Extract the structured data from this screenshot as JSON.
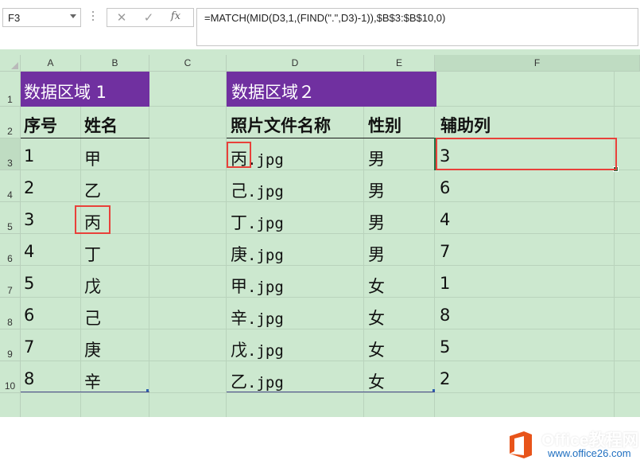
{
  "formula_bar": {
    "name_box": "F3",
    "cancel_glyph": "✕",
    "enter_glyph": "✓",
    "fx_label": "fx",
    "formula": "=MATCH(MID(D3,1,(FIND(\".\",D3)-1)),$B$3:$B$10,0)"
  },
  "columns": [
    "A",
    "B",
    "C",
    "D",
    "E",
    "F"
  ],
  "rows": [
    "1",
    "2",
    "3",
    "4",
    "5",
    "6",
    "7",
    "8",
    "9",
    "10"
  ],
  "sheet": {
    "region1_title": "数据区域 1",
    "region2_title": "数据区域２",
    "headers": {
      "seq": "序号",
      "name": "姓名",
      "photo_file": "照片文件名称",
      "gender": "性别",
      "helper": "辅助列"
    },
    "region1_rows": [
      {
        "seq": "1",
        "name": "甲"
      },
      {
        "seq": "2",
        "name": "乙"
      },
      {
        "seq": "3",
        "name": "丙"
      },
      {
        "seq": "4",
        "name": "丁"
      },
      {
        "seq": "5",
        "name": "戊"
      },
      {
        "seq": "6",
        "name": "己"
      },
      {
        "seq": "7",
        "name": "庚"
      },
      {
        "seq": "8",
        "name": "辛"
      }
    ],
    "region2_rows": [
      {
        "file_char": "丙",
        "file_ext": ".jpg",
        "gender": "男",
        "helper": "3"
      },
      {
        "file_char": "己",
        "file_ext": ".jpg",
        "gender": "男",
        "helper": "6"
      },
      {
        "file_char": "丁",
        "file_ext": ".jpg",
        "gender": "男",
        "helper": "4"
      },
      {
        "file_char": "庚",
        "file_ext": ".jpg",
        "gender": "男",
        "helper": "7"
      },
      {
        "file_char": "甲",
        "file_ext": ".jpg",
        "gender": "女",
        "helper": "1"
      },
      {
        "file_char": "辛",
        "file_ext": ".jpg",
        "gender": "女",
        "helper": "8"
      },
      {
        "file_char": "戊",
        "file_ext": ".jpg",
        "gender": "女",
        "helper": "5"
      },
      {
        "file_char": "乙",
        "file_ext": ".jpg",
        "gender": "女",
        "helper": "2"
      }
    ]
  },
  "watermark": {
    "brand": "Office教程网",
    "url": "www.office26.com"
  },
  "colors": {
    "title_fill": "#7030a0",
    "sheet_background": "#cce8cf",
    "highlight_box": "#e8413a"
  }
}
